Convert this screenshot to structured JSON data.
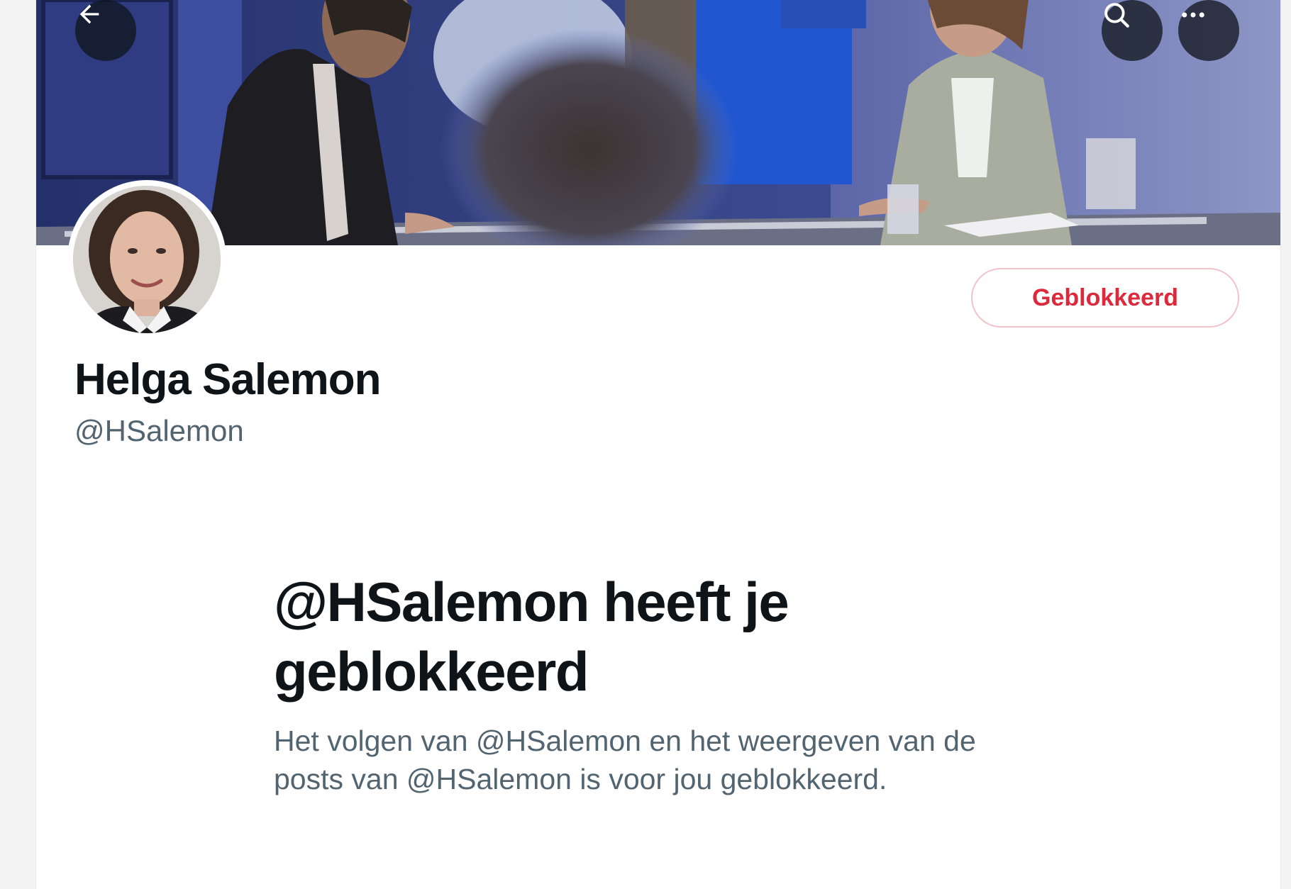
{
  "header": {
    "back_icon": "arrow-left-icon",
    "search_icon": "search-icon",
    "more_icon": "more-horizontal-icon",
    "banner_colors": {
      "background": "#2a3674",
      "jacket_dark": "#1d1d22",
      "jacket_grey": "#a9ad9f",
      "blue_shirt": "#1f4fc7"
    }
  },
  "profile": {
    "display_name": "Helga Salemon",
    "handle": "@HSalemon",
    "blocked_button_label": "Geblokkeerd",
    "accent_color": "#dc2a3c"
  },
  "blocked_notice": {
    "title": "@HSalemon heeft je geblokkeerd",
    "description": "Het volgen van @HSalemon en het weergeven van de posts van @HSalemon is voor jou geblokkeerd."
  }
}
